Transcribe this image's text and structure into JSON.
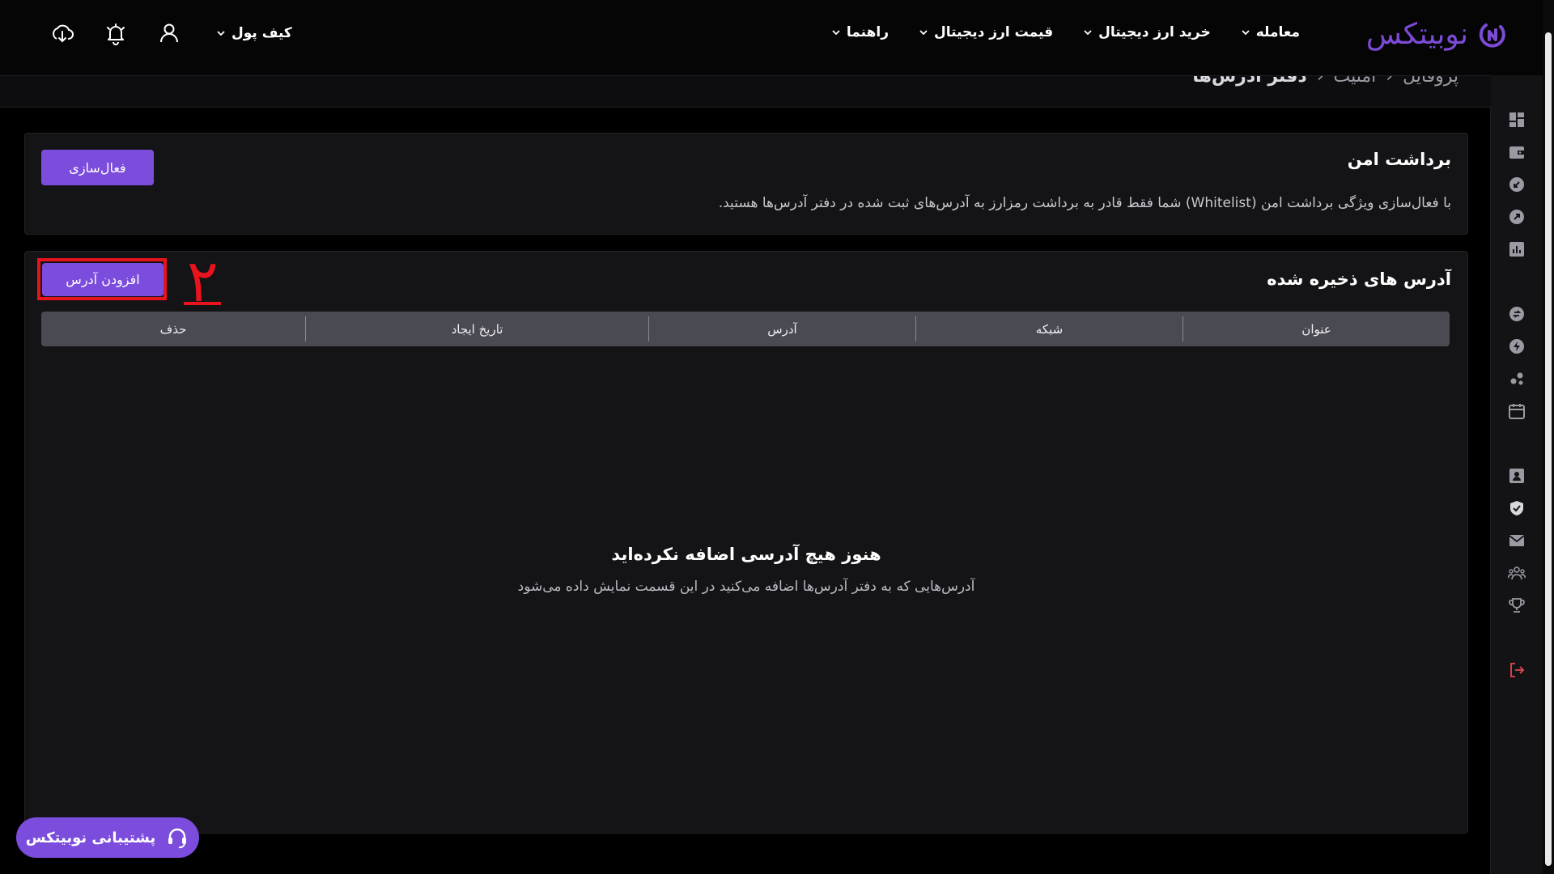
{
  "header": {
    "logo_text": "نوبیتکس",
    "nav": [
      {
        "label": "معامله"
      },
      {
        "label": "خرید ارز دیجیتال"
      },
      {
        "label": "قیمت ارز دیجیتال"
      },
      {
        "label": "راهنما"
      }
    ],
    "wallet_label": "کیف پول"
  },
  "breadcrumb": {
    "items": [
      "پروفایل",
      "امنیت"
    ],
    "current": "دفتر آدرس‌ها"
  },
  "secure_withdraw": {
    "title": "برداشت امن",
    "description": "با فعال‌سازی ویژگی برداشت امن (Whitelist) شما فقط قادر به برداشت رمزارز به آدرس‌های ثبت شده در دفتر آدرس‌ها هستید.",
    "activate_label": "فعال‌سازی"
  },
  "saved_addresses": {
    "title": "آدرس های ذخیره شده",
    "add_label": "افزودن آدرس",
    "annotation_number": "٢",
    "columns": [
      "عنوان",
      "شبکه",
      "آدرس",
      "تاریخ ایجاد",
      "حذف"
    ],
    "empty_title": "هنوز هیچ آدرسی اضافه نکرده‌اید",
    "empty_subtitle": "آدرس‌هایی که به دفتر آدرس‌ها اضافه می‌کنید در این قسمت نمایش داده می‌شود"
  },
  "support": {
    "label": "پشتیبانی نوبیتکس"
  },
  "colors": {
    "accent": "#7c4ddc",
    "annotation": "#e8131c",
    "logout": "#e5484d"
  }
}
